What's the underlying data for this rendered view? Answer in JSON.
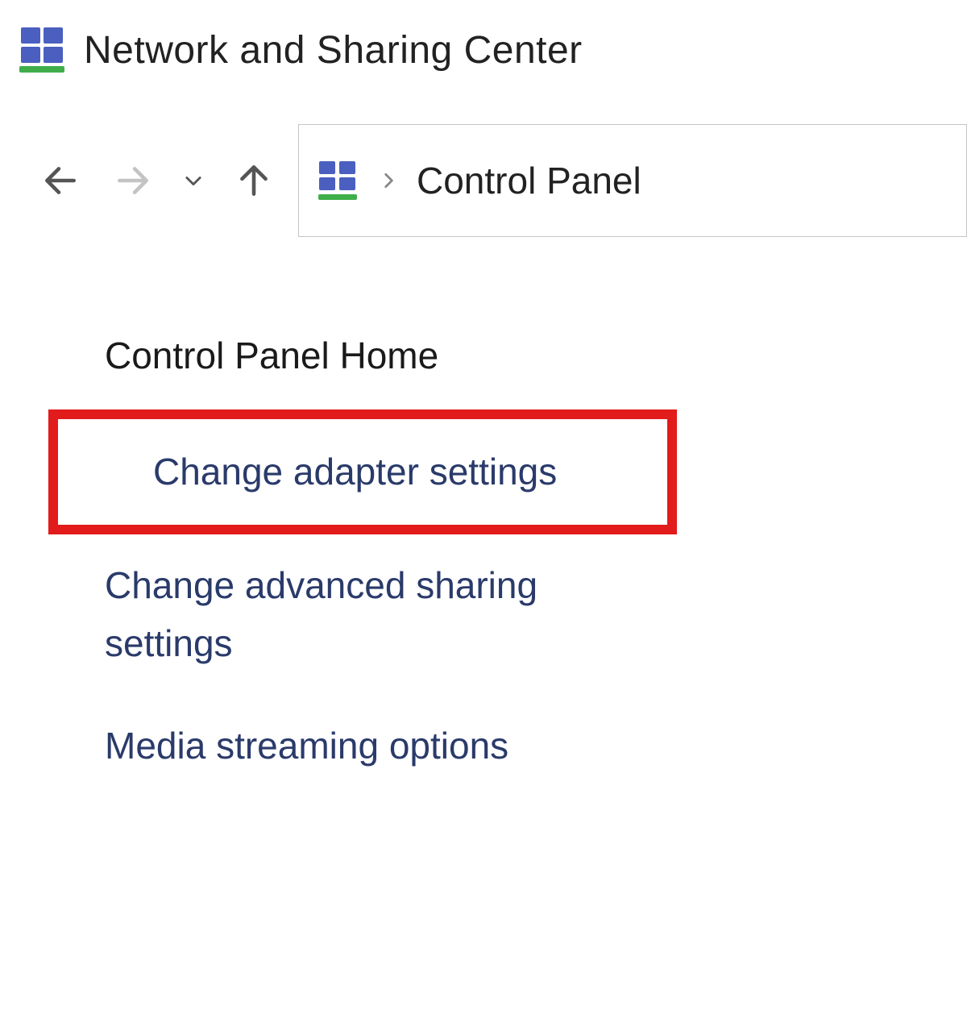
{
  "window": {
    "title": "Network and Sharing Center"
  },
  "breadcrumb": {
    "items": [
      "Control Panel"
    ]
  },
  "sidebar": {
    "heading": "Control Panel Home",
    "links": [
      "Change adapter settings",
      "Change advanced sharing settings",
      "Media streaming options"
    ]
  }
}
